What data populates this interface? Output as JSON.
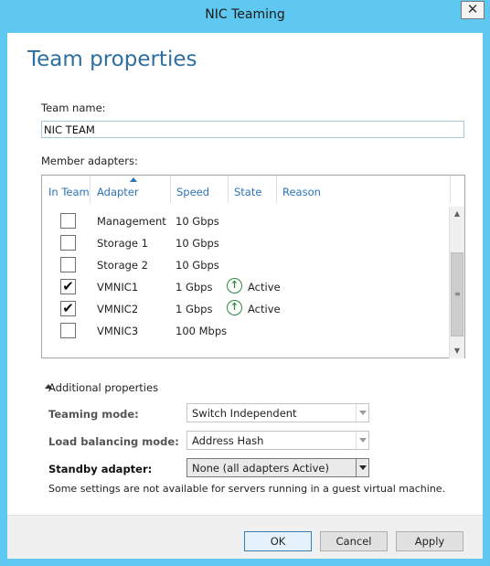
{
  "window": {
    "title": "NIC Teaming",
    "close_glyph": "✕"
  },
  "heading": "Team properties",
  "team_name": {
    "label": "Team name:",
    "value": "NIC TEAM"
  },
  "members": {
    "label": "Member adapters:",
    "columns": [
      "In Team",
      "Adapter",
      "Speed",
      "State",
      "Reason"
    ],
    "sorted_column": "Adapter",
    "rows": [
      {
        "adapter": "Management",
        "speed": "10 Gbps",
        "state": "",
        "reason": "",
        "in_team": false
      },
      {
        "adapter": "Storage 1",
        "speed": "10 Gbps",
        "state": "",
        "reason": "",
        "in_team": false
      },
      {
        "adapter": "Storage 2",
        "speed": "10 Gbps",
        "state": "",
        "reason": "",
        "in_team": false
      },
      {
        "adapter": "VMNIC1",
        "speed": "1 Gbps",
        "state": "Active",
        "reason": "",
        "in_team": true
      },
      {
        "adapter": "VMNIC2",
        "speed": "1 Gbps",
        "state": "Active",
        "reason": "",
        "in_team": true
      },
      {
        "adapter": "VMNIC3",
        "speed": "100 Mbps",
        "state": "",
        "reason": "",
        "in_team": false
      }
    ],
    "check_glyph": "✔",
    "state_icon_glyph": "↑",
    "state_icon_color": "#2c8a3a"
  },
  "additional": {
    "toggle_label": "Additional properties",
    "teaming_mode": {
      "label": "Teaming mode:",
      "value": "Switch Independent"
    },
    "load_balancing": {
      "label": "Load balancing mode:",
      "value": "Address Hash"
    },
    "standby": {
      "label": "Standby adapter:",
      "value": "None (all adapters Active)"
    },
    "note": "Some settings are not available for servers running in a guest virtual machine."
  },
  "buttons": {
    "ok": "OK",
    "cancel": "Cancel",
    "apply": "Apply"
  },
  "colors": {
    "titlebar": "#5fc8f0",
    "heading": "#2e6f9f",
    "column_header": "#2e75b6"
  }
}
